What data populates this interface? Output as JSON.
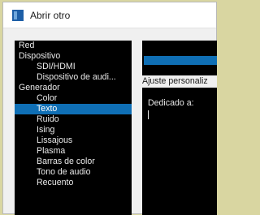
{
  "window": {
    "title": "Abrir otro"
  },
  "tree": {
    "items": [
      {
        "label": "Red",
        "level": 0,
        "selected": false
      },
      {
        "label": "Dispositivo",
        "level": 0,
        "selected": false
      },
      {
        "label": "SDI/HDMI",
        "level": 1,
        "selected": false
      },
      {
        "label": "Dispositivo de audi...",
        "level": 1,
        "selected": false
      },
      {
        "label": "Generador",
        "level": 0,
        "selected": false
      },
      {
        "label": "Color",
        "level": 1,
        "selected": false
      },
      {
        "label": "Texto",
        "level": 1,
        "selected": true
      },
      {
        "label": "Ruido",
        "level": 1,
        "selected": false
      },
      {
        "label": "Ising",
        "level": 1,
        "selected": false
      },
      {
        "label": "Lissajous",
        "level": 1,
        "selected": false
      },
      {
        "label": "Plasma",
        "level": 1,
        "selected": false
      },
      {
        "label": "Barras de color",
        "level": 1,
        "selected": false
      },
      {
        "label": "Tono de audio",
        "level": 1,
        "selected": false
      },
      {
        "label": "Recuento",
        "level": 1,
        "selected": false
      }
    ]
  },
  "panel": {
    "ajuste_label": "Ajuste personaliz",
    "text_field": {
      "value": "Dedicado a:"
    }
  },
  "colors": {
    "selection": "#0f6fb5",
    "list_background": "#000000",
    "desktop": "#d9d6a1"
  }
}
